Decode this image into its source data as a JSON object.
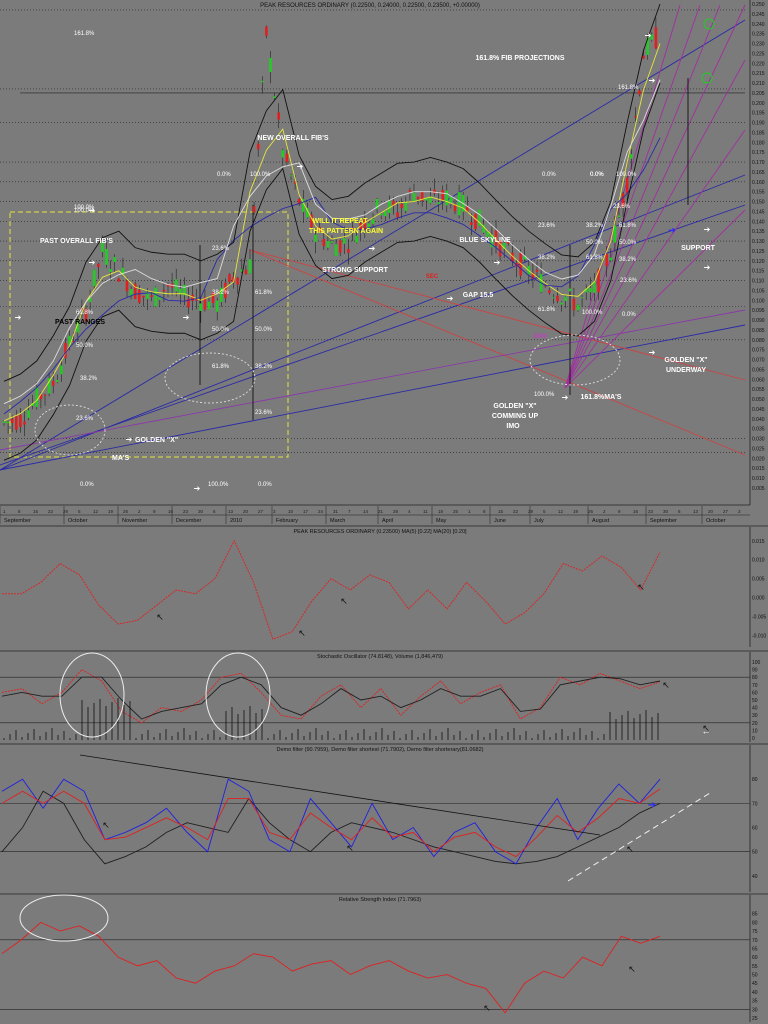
{
  "header": "PEAK RESOURCES ORDINARY (0.22500, 0.24000, 0.22500, 0.23500, +0.00000)",
  "panels": {
    "p2": "PEAK RESOURCES ORDINARY (0.23500) MA(5) [0.22] MA(20) [0.20]",
    "p3": "Stochastic Oscillator (74.8148), Volume (1,846,479)",
    "p4": "Demo filter (90.7959), Demo filter shortest (71.7902), Demo filter shorterary(81.0682)",
    "p5": "Relative Strength Index (71.7963)"
  },
  "annotations": [
    {
      "id": "fib-proj",
      "text": "161.8% FIB PROJECTIONS",
      "color": "#ffffff"
    },
    {
      "id": "new-fibs",
      "text": "NEW OVERALL FIB'S",
      "color": "#ffffff"
    },
    {
      "id": "repeat1",
      "text": "WILL IT REPEAT",
      "color": "#ffff33"
    },
    {
      "id": "repeat2",
      "text": "THIS PATTERN AGAIN",
      "color": "#ffff33"
    },
    {
      "id": "past-fibs",
      "text": "PAST OVERALL FIB'S",
      "color": "#ffffff"
    },
    {
      "id": "past-ranges",
      "text": "PAST RANGES",
      "color": "#000000"
    },
    {
      "id": "strong-support",
      "text": "STRONG SUPPORT",
      "color": "#ffffff"
    },
    {
      "id": "blue-skyline",
      "text": "BLUE SKYLINE",
      "color": "#ffffff"
    },
    {
      "id": "gap",
      "text": "GAP 15.5",
      "color": "#ffffff"
    },
    {
      "id": "support",
      "text": "SUPPORT",
      "color": "#ffffff"
    },
    {
      "id": "golden-x1",
      "text": "GOLDEN \"X\"",
      "color": "#ffffff"
    },
    {
      "id": "golden-x1b",
      "text": "UNDERWAY",
      "color": "#ffffff"
    },
    {
      "id": "golden-x2",
      "text": "GOLDEN \"X\"",
      "color": "#ffffff"
    },
    {
      "id": "coming-up",
      "text": "COMMING UP",
      "color": "#ffffff"
    },
    {
      "id": "imo",
      "text": "IMO",
      "color": "#ffffff"
    },
    {
      "id": "golden-x3",
      "text": "GOLDEN \"X\"",
      "color": "#ffffff"
    },
    {
      "id": "mas",
      "text": "MA'S",
      "color": "#ffffff"
    },
    {
      "id": "mas2",
      "text": "161.8%MA'S",
      "color": "#ffffff"
    }
  ],
  "fib_labels": [
    {
      "id": "f1618a",
      "text": "161.8%"
    },
    {
      "id": "f1618b",
      "text": "161.8%"
    },
    {
      "id": "f0a",
      "text": "0.0%"
    },
    {
      "id": "f100a",
      "text": "100.0%"
    },
    {
      "id": "f0b",
      "text": "0.0%"
    },
    {
      "id": "f0c",
      "text": "0.0%"
    },
    {
      "id": "f100b",
      "text": "100.0%"
    },
    {
      "id": "f100c",
      "text": "100.0%"
    },
    {
      "id": "f236a",
      "text": "23.6%"
    },
    {
      "id": "f382a",
      "text": "38.2%"
    },
    {
      "id": "f618a",
      "text": "61.8%"
    },
    {
      "id": "f50a",
      "text": "50.0%"
    },
    {
      "id": "f50b",
      "text": "50.0%"
    },
    {
      "id": "f618b",
      "text": "61.8%"
    },
    {
      "id": "f382b",
      "text": "38.2%"
    },
    {
      "id": "f236b",
      "text": "23.6%"
    },
    {
      "id": "f618c",
      "text": "61.8%"
    },
    {
      "id": "f50c",
      "text": "50.0%"
    },
    {
      "id": "f382c",
      "text": "38.2%"
    },
    {
      "id": "f236c",
      "text": "23.6%"
    },
    {
      "id": "f0d",
      "text": "0.0%"
    },
    {
      "id": "f100d",
      "text": "100.0%"
    },
    {
      "id": "f0e",
      "text": "0.0%"
    },
    {
      "id": "f236d",
      "text": "23.6%"
    },
    {
      "id": "f382d",
      "text": "38.2%"
    },
    {
      "id": "f50d",
      "text": "50.0%"
    },
    {
      "id": "f618d",
      "text": "61.8%"
    },
    {
      "id": "f100e",
      "text": "100.0%"
    },
    {
      "id": "f236e",
      "text": "23.6%"
    },
    {
      "id": "f382e",
      "text": "38.2%"
    },
    {
      "id": "f618e",
      "text": "61.8%"
    },
    {
      "id": "f50e",
      "text": "50.0%"
    },
    {
      "id": "f382f",
      "text": "38.2%"
    },
    {
      "id": "f618f",
      "text": "61.8%"
    },
    {
      "id": "f236f",
      "text": "23.6%"
    },
    {
      "id": "f100f",
      "text": "100.0%"
    },
    {
      "id": "f0f",
      "text": "0.0%"
    },
    {
      "id": "f100g",
      "text": "100.0%"
    },
    {
      "id": "f0g",
      "text": "0.0%"
    }
  ],
  "months": [
    "September",
    "October",
    "November",
    "December",
    "2010",
    "February",
    "March",
    "April",
    "May",
    "June",
    "July",
    "August",
    "September",
    "October"
  ],
  "chart_data": [
    {
      "type": "line",
      "title": "PEAK RESOURCES ORDINARY (0.22500, 0.24000, 0.22500, 0.23500, +0.00000)",
      "y_ticks": [
        "0.250",
        "0.245",
        "0.240",
        "0.235",
        "0.230",
        "0.225",
        "0.220",
        "0.215",
        "0.210",
        "0.205",
        "0.200",
        "0.195",
        "0.190",
        "0.185",
        "0.180",
        "0.175",
        "0.170",
        "0.165",
        "0.160",
        "0.155",
        "0.150",
        "0.145",
        "0.140",
        "0.135",
        "0.130",
        "0.125",
        "0.120",
        "0.115",
        "0.110",
        "0.105",
        "0.100",
        "0.095",
        "0.090",
        "0.085",
        "0.080",
        "0.075",
        "0.070",
        "0.065",
        "0.060",
        "0.055",
        "0.050",
        "0.045",
        "0.040",
        "0.035",
        "0.030",
        "0.025",
        "0.020",
        "0.015",
        "0.010",
        "0.005"
      ],
      "ylim": [
        0.005,
        0.25
      ],
      "series": [
        {
          "name": "price",
          "color": "#e02020",
          "values": [
            0.038,
            0.04,
            0.05,
            0.058,
            0.078,
            0.095,
            0.125,
            0.115,
            0.105,
            0.1,
            0.108,
            0.102,
            0.1,
            0.098,
            0.112,
            0.118,
            0.235,
            0.175,
            0.15,
            0.135,
            0.128,
            0.13,
            0.14,
            0.148,
            0.145,
            0.155,
            0.15,
            0.152,
            0.148,
            0.14,
            0.13,
            0.122,
            0.115,
            0.108,
            0.103,
            0.098,
            0.105,
            0.125,
            0.16,
            0.225,
            0.235
          ]
        }
      ]
    },
    {
      "type": "line",
      "title": "PEAK RESOURCES ORDINARY (0.23500) MA(5) [0.22] MA(20) [0.20]",
      "y_ticks": [
        "0.015",
        "0.010",
        "0.005",
        "0.000",
        "-0.005",
        "-0.010"
      ],
      "ylim": [
        -0.012,
        0.016
      ],
      "series": [
        {
          "name": "oscillator",
          "color": "#e02020",
          "values": [
            0.001,
            0.001,
            0.004,
            0.009,
            0.006,
            -0.002,
            -0.007,
            -0.006,
            -0.002,
            0.002,
            0.001,
            0.005,
            0.015,
            0.004,
            -0.011,
            -0.009,
            -0.001,
            0.005,
            0.002,
            0.006,
            0.004,
            -0.003,
            0.002,
            -0.003,
            0.004,
            -0.001,
            -0.007,
            -0.004,
            0.001,
            0.009,
            0.007,
            0.011,
            0.008,
            0.002,
            0.012
          ]
        }
      ]
    },
    {
      "type": "line",
      "title": "Stochastic Oscillator (74.8148), Volume (1,846,479)",
      "y_ticks": [
        "100",
        "90",
        "80",
        "70",
        "60",
        "50",
        "40",
        "30",
        "20",
        "10",
        "0"
      ],
      "ylim": [
        0,
        100
      ],
      "series": [
        {
          "name": "%K",
          "color": "#e02020",
          "values": [
            60,
            65,
            45,
            60,
            90,
            75,
            35,
            20,
            40,
            35,
            50,
            80,
            85,
            60,
            30,
            25,
            55,
            70,
            40,
            65,
            30,
            55,
            75,
            45,
            60,
            70,
            25,
            40,
            80,
            70,
            85,
            75,
            65,
            74
          ]
        },
        {
          "name": "%D",
          "color": "#202020",
          "values": [
            55,
            60,
            55,
            55,
            80,
            80,
            50,
            25,
            35,
            40,
            45,
            70,
            80,
            70,
            40,
            30,
            45,
            65,
            50,
            55,
            40,
            50,
            65,
            55,
            55,
            65,
            35,
            38,
            70,
            75,
            80,
            78,
            70,
            75
          ]
        }
      ]
    },
    {
      "type": "line",
      "title": "Demo filter (90.7959), Demo filter shortest (71.7902), Demo filter shorterary(81.0682)",
      "y_ticks": [
        "80",
        "70",
        "60",
        "50",
        "40"
      ],
      "ylim": [
        35,
        90
      ],
      "series": [
        {
          "name": "Demo filter",
          "color": "#202020",
          "values": [
            50,
            60,
            75,
            70,
            55,
            45,
            48,
            52,
            58,
            62,
            60,
            58,
            72,
            62,
            55,
            50,
            58,
            62,
            60,
            58,
            55,
            52,
            50,
            48,
            46,
            45,
            46,
            48,
            52,
            56,
            60,
            66,
            70
          ]
        },
        {
          "name": "Demo filter shortest",
          "color": "#2020e0",
          "values": [
            75,
            80,
            68,
            80,
            75,
            55,
            58,
            62,
            68,
            58,
            50,
            80,
            75,
            55,
            50,
            72,
            62,
            52,
            70,
            55,
            60,
            48,
            58,
            62,
            50,
            45,
            60,
            72,
            55,
            68,
            78,
            70,
            80
          ]
        },
        {
          "name": "Demo filter shorterary",
          "color": "#e02020",
          "values": [
            70,
            75,
            70,
            75,
            70,
            55,
            56,
            60,
            64,
            60,
            55,
            72,
            72,
            58,
            55,
            66,
            60,
            55,
            64,
            56,
            58,
            50,
            56,
            58,
            52,
            48,
            56,
            65,
            58,
            64,
            72,
            70,
            76
          ]
        }
      ]
    },
    {
      "type": "line",
      "title": "Relative Strength Index (71.7963)",
      "y_ticks": [
        "85",
        "80",
        "75",
        "70",
        "65",
        "60",
        "55",
        "50",
        "45",
        "40",
        "35",
        "30",
        "25"
      ],
      "ylim": [
        25,
        90
      ],
      "series": [
        {
          "name": "RSI",
          "color": "#e02020",
          "values": [
            62,
            70,
            80,
            75,
            78,
            72,
            60,
            55,
            58,
            48,
            45,
            52,
            55,
            62,
            60,
            52,
            56,
            58,
            50,
            55,
            58,
            52,
            48,
            50,
            45,
            42,
            28,
            45,
            52,
            48,
            60,
            55,
            72,
            68,
            72
          ]
        }
      ]
    }
  ]
}
